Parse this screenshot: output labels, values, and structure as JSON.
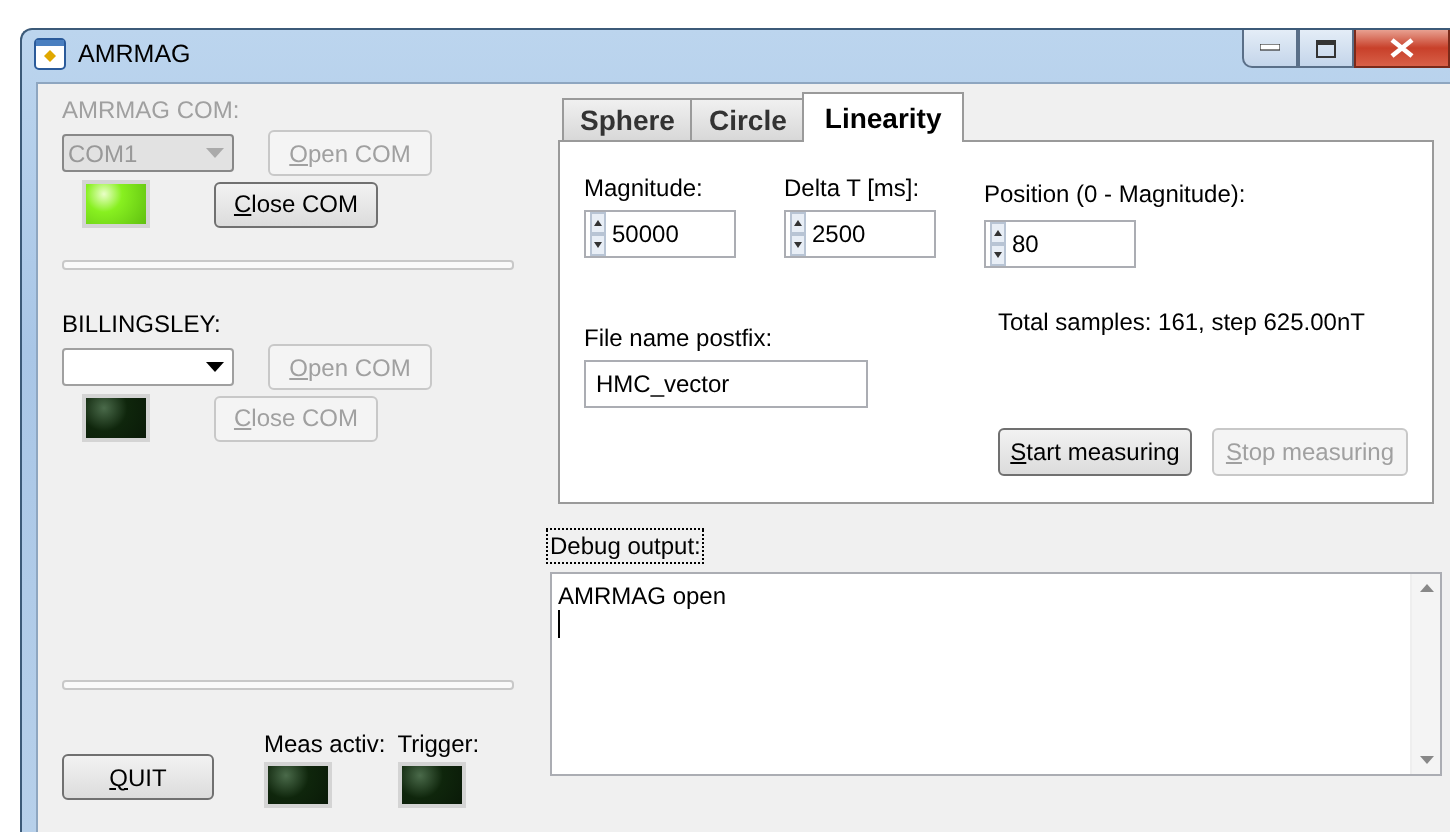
{
  "window": {
    "title": "AMRMAG"
  },
  "amrmag": {
    "label": "AMRMAG COM:",
    "disabled": true,
    "port": {
      "value": "COM1",
      "disabled": true
    },
    "led_on": true,
    "buttons": [
      {
        "label": "Open COM",
        "disabled": true
      },
      {
        "label": "Close COM",
        "disabled": false
      }
    ]
  },
  "billingsley": {
    "label": "BILLINGSLEY:",
    "disabled": false,
    "port": {
      "disabled": false
    },
    "led_on": false,
    "buttons": [
      {
        "label": "Open COM",
        "disabled": true
      },
      {
        "label": "Close COM",
        "disabled": true
      }
    ]
  },
  "quit_button": "QUIT",
  "indicators": [
    {
      "label": "Meas activ:",
      "on": false
    },
    {
      "label": "Trigger:",
      "on": false
    }
  ],
  "tabs": [
    {
      "label": "Sphere",
      "selected": false
    },
    {
      "label": "Circle",
      "selected": false
    },
    {
      "label": "Linearity",
      "selected": true
    }
  ],
  "fields": [
    {
      "label": "Magnitude:",
      "value": "50000"
    },
    {
      "label": "Delta T [ms]:",
      "value": "2500"
    },
    {
      "label": "Position (0 - Magnitude):",
      "value": "80"
    }
  ],
  "file_postfix": {
    "label": "File name postfix:",
    "value": "HMC_vector"
  },
  "total_samples": "Total samples: 161, step 625.00nT",
  "actions": [
    {
      "label": "Start measuring",
      "disabled": false
    },
    {
      "label": "Stop measuring",
      "disabled": true
    }
  ],
  "debug": {
    "label": "Debug output:",
    "lines": [
      "AMRMAG open"
    ]
  }
}
